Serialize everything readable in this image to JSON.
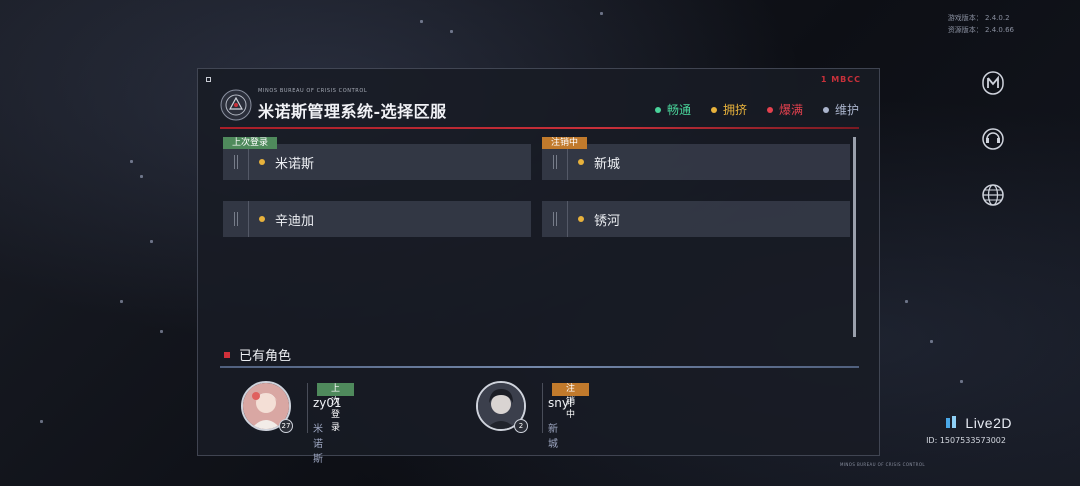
{
  "version": {
    "game_label": "游戏版本：",
    "game_value": "2.4.0.2",
    "res_label": "资源版本：",
    "res_value": "2.4.0.66"
  },
  "panel": {
    "corner_tag": "1 MBCC",
    "bureau_name": "MINOS BUREAU OF CRISIS CONTROL",
    "title": "米诺斯管理系统-选择区服",
    "footer_text": "MINOS BUREAU OF CRISIS CONTROL"
  },
  "legend": [
    {
      "label": "畅通",
      "color": "#49d39a"
    },
    {
      "label": "拥挤",
      "color": "#e8b23c"
    },
    {
      "label": "爆满",
      "color": "#e4414e"
    },
    {
      "label": "维护",
      "color": "#aab4cc"
    }
  ],
  "servers": [
    {
      "name": "米诺斯",
      "status_color": "#e8b23c",
      "tag": "上次登录"
    },
    {
      "name": "新城",
      "status_color": "#e8b23c",
      "tag": "注销中"
    },
    {
      "name": "辛迪加",
      "status_color": "#e8b23c",
      "tag": ""
    },
    {
      "name": "锈河",
      "status_color": "#e8b23c",
      "tag": ""
    }
  ],
  "characters_section": {
    "title": "已有角色"
  },
  "characters": [
    {
      "name": "zy01",
      "server": "米诺斯",
      "tag": "上次登录",
      "level": "27"
    },
    {
      "name": "snyl",
      "server": "新城",
      "tag": "注销中",
      "level": "2"
    }
  ],
  "branding": {
    "live2d": "Live2D",
    "user_id": "ID: 1507533573002"
  }
}
